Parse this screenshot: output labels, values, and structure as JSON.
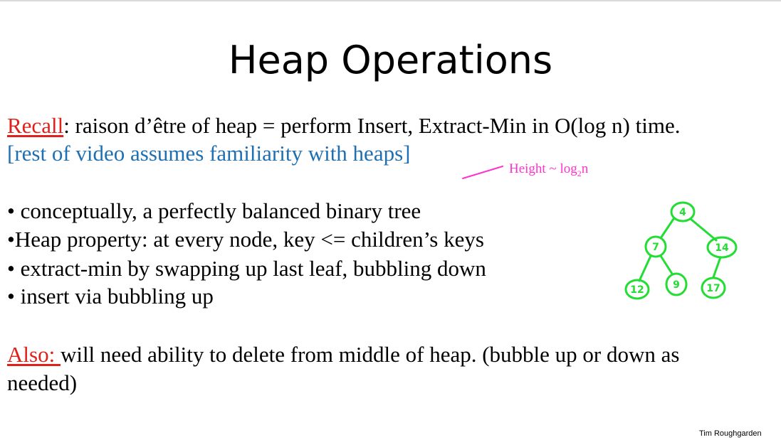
{
  "slide": {
    "title": "Heap Operations",
    "recall": {
      "label": "Recall",
      "text": ": raison d’être of heap = perform Insert, Extract-Min in O(log n) time."
    },
    "note": "[rest of video assumes familiarity with heaps]",
    "bullets": [
      "• conceptually, a perfectly balanced binary tree",
      "•Heap property: at every node, key <= children’s keys",
      "• extract-min by swapping up last leaf, bubbling down",
      "• insert via bubbling up"
    ],
    "also": {
      "label": "Also: ",
      "text": "will need ability to delete from middle of heap. (bubble up or down as",
      "text_line2": "needed)"
    },
    "height_annotation": {
      "prefix": "Height ~ log",
      "subscript": "2",
      "suffix": "n"
    },
    "author": "Tim Roughgarden"
  },
  "tree": {
    "nodes": [
      "4",
      "7",
      "14",
      "12",
      "9",
      "17"
    ],
    "ink_color": "#22dd33",
    "annotation_color": "#ff33cc"
  }
}
